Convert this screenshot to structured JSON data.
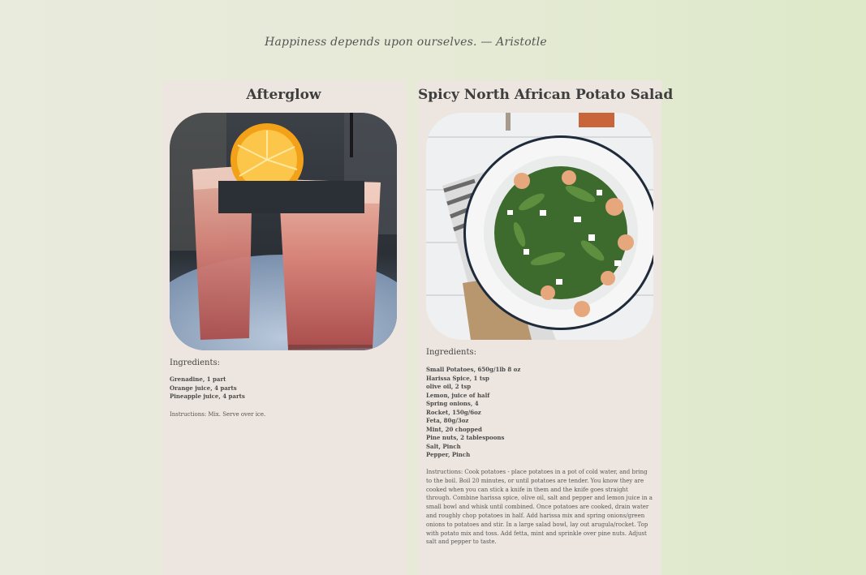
{
  "quote": "Happiness depends upon ourselves. — Aristotle",
  "recipes": [
    {
      "title": "Afterglow",
      "ingredients_heading": "Ingredients:",
      "ingredients": [
        "Grenadine, 1 part",
        "Orange juice, 4 parts",
        "Pineapple juice, 4 parts"
      ],
      "instructions": "Instructions: Mix. Serve over ice."
    },
    {
      "title": "Spicy North African Potato Salad",
      "ingredients_heading": "Ingredients:",
      "ingredients": [
        "Small Potatoes, 650g/1lb 8 oz",
        "Harissa Spice, 1 tsp",
        "olive oil, 2 tsp",
        "Lemon, juice of half",
        "Spring onions, 4",
        "Rocket, 150g/6oz",
        "Feta, 80g/3oz",
        "Mint, 20 chopped",
        "Pine nuts, 2 tablespoons",
        "Salt, Pinch",
        "Pepper, Pinch"
      ],
      "instructions": "Instructions: Cook potatoes - place potatoes in a pot of cold water, and bring to the boil. Boil 20 minutes, or until potatoes are tender. You know they are cooked when you can stick a knife in them and the knife goes straight through. Combine harissa spice, olive oil, salt and pepper and lemon juice in a small bowl and whisk until combined. Once potatoes are cooked, drain water and roughly chop potatoes in half. Add harissa mix and spring onions/green onions to potatoes and stir. In a large salad bowl, lay out arugula/rocket. Top with potato mix and toss. Add fetta, mint and sprinkle over pine nuts. Adjust salt and pepper to taste."
    }
  ]
}
